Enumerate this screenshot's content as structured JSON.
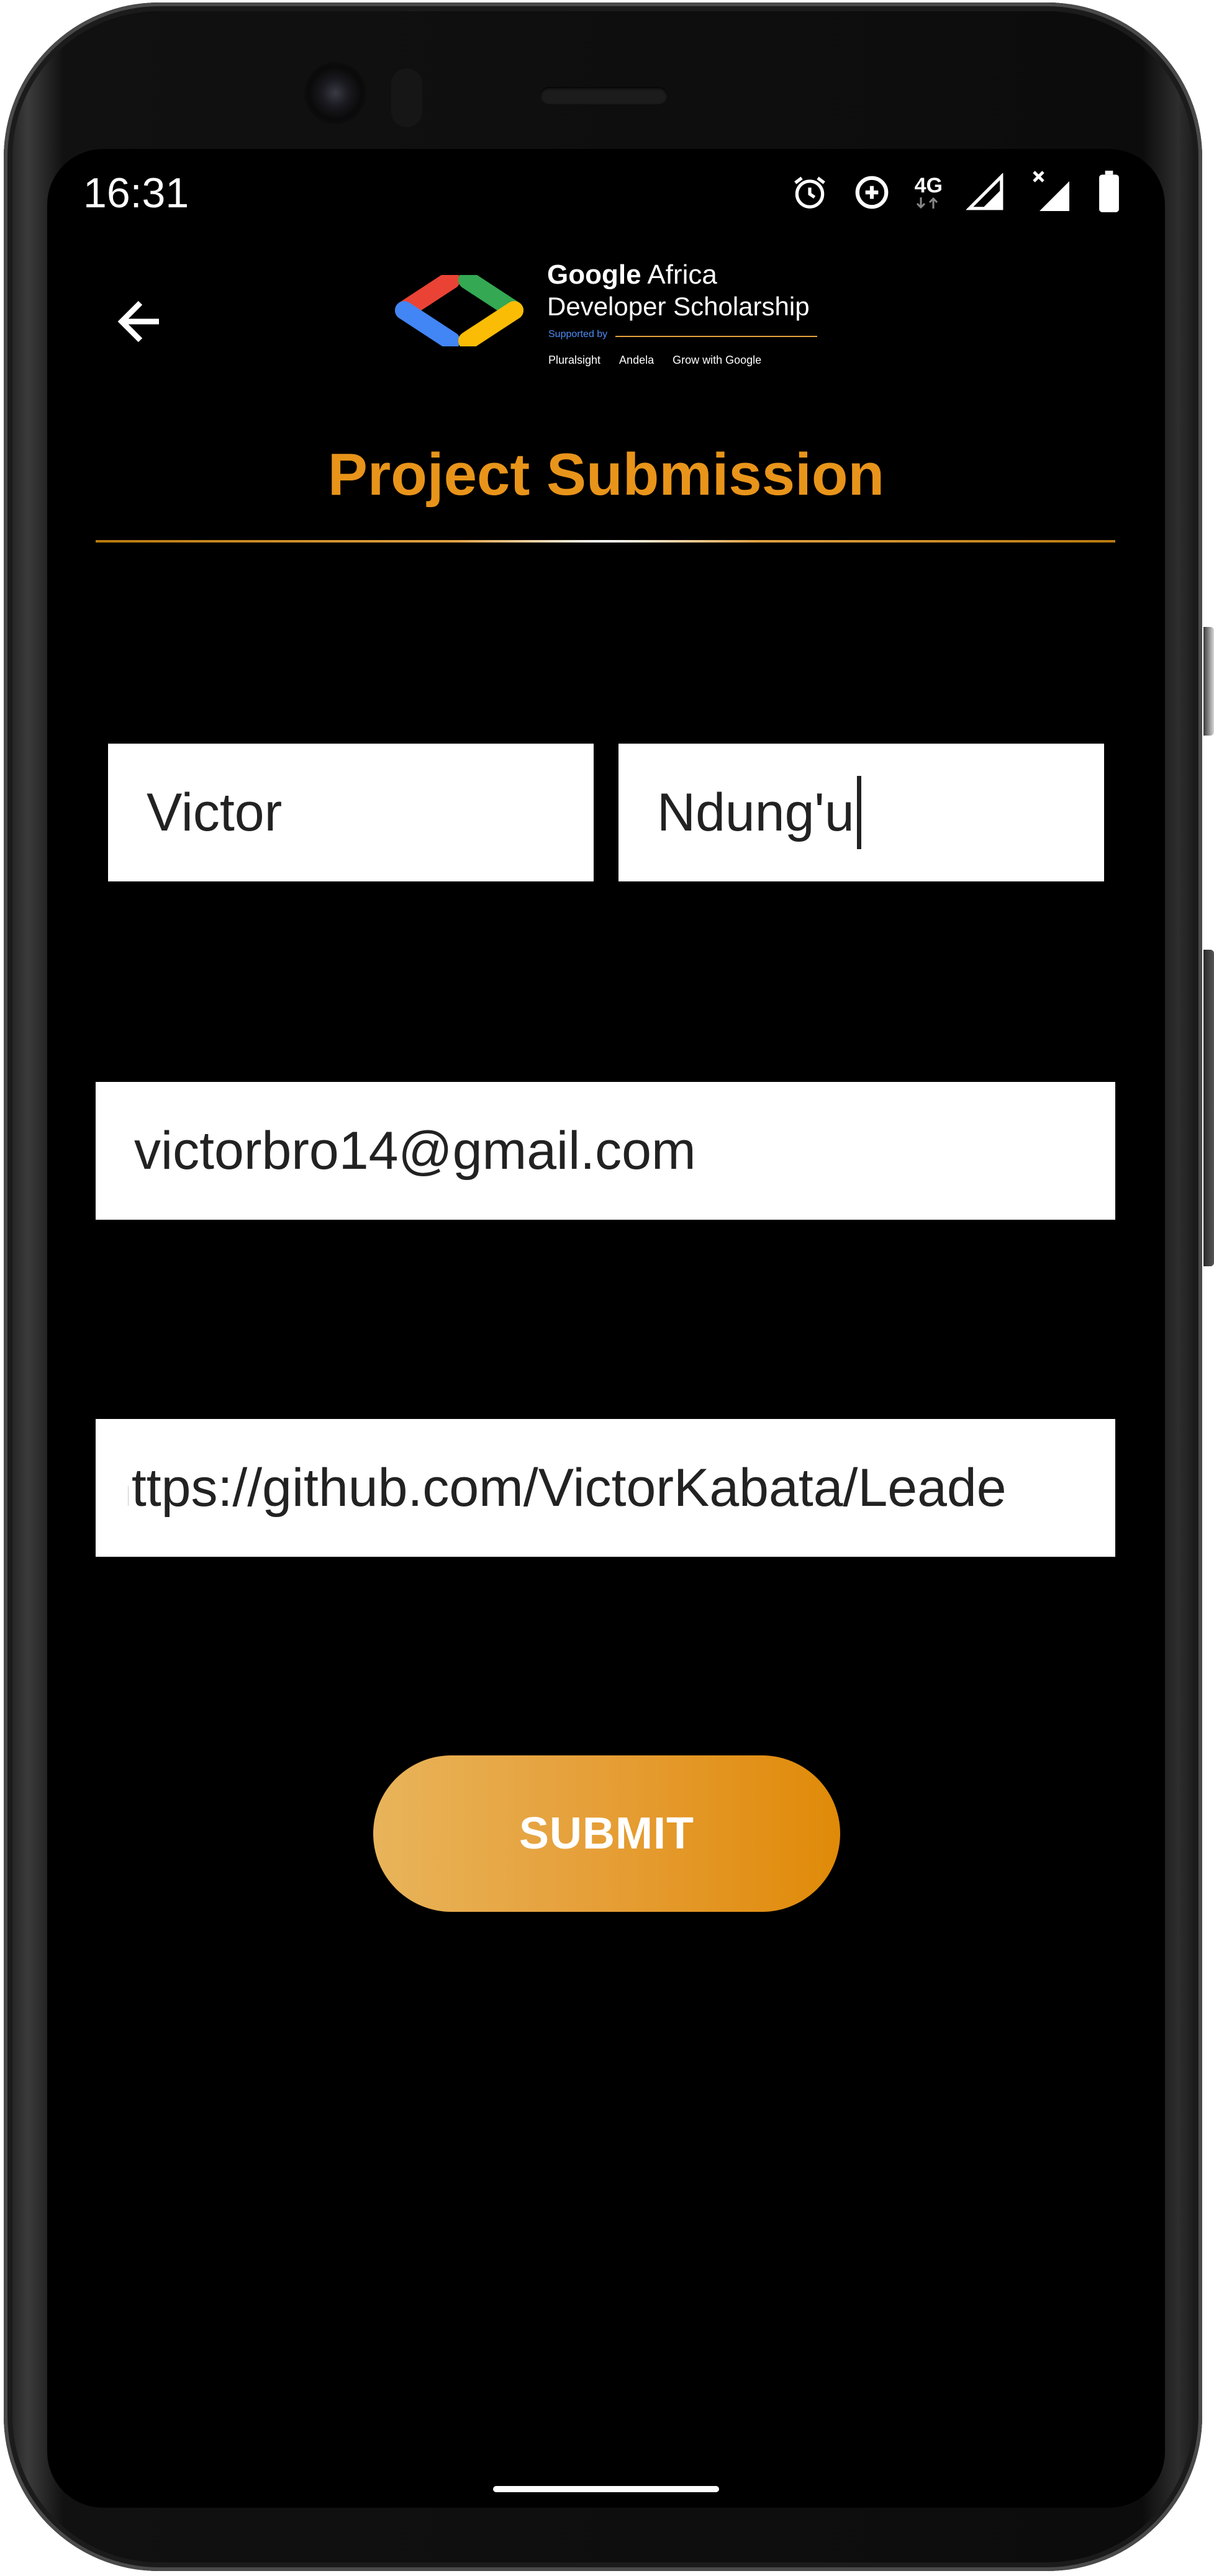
{
  "status_bar": {
    "time": "16:31",
    "network": "4G",
    "icons": [
      "alarm-icon",
      "data-saver-icon",
      "network-4g-icon",
      "signal-icon",
      "signal-no-data-icon",
      "battery-icon"
    ]
  },
  "app_bar": {
    "back_icon": "arrow-back-icon",
    "logo": {
      "brand": "Google",
      "line1_rest": "Africa",
      "line2": "Developer Scholarship",
      "supported_by": "Supported by",
      "partners": [
        "Pluralsight",
        "Andela",
        "Grow with Google"
      ]
    }
  },
  "page": {
    "title": "Project Submission",
    "accent_color": "#e8941a"
  },
  "form": {
    "first_name": "Victor",
    "last_name": "Ndung'u",
    "email": "victorbro14@gmail.com",
    "project_link": "https://github.com/VictorKabata/Leade",
    "submit_label": "SUBMIT"
  }
}
